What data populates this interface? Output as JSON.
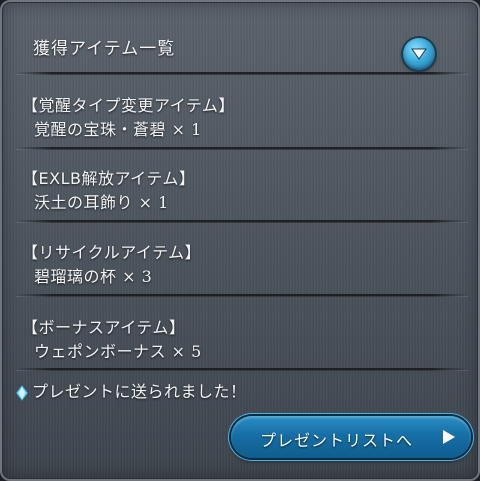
{
  "header": {
    "title": "獲得アイテム一覧"
  },
  "categories": [
    {
      "title": "【覚醒タイプ変更アイテム】",
      "item": "覚醒の宝珠・蒼碧",
      "qty": "× 1"
    },
    {
      "title": "【EXLB解放アイテム】",
      "item": "沃土の耳飾り",
      "qty": "× 1"
    },
    {
      "title": "【リサイクルアイテム】",
      "item": "碧瑠璃の杯",
      "qty": "× 3"
    },
    {
      "title": "【ボーナスアイテム】",
      "item": "ウェポンボーナス",
      "qty": "× 5"
    }
  ],
  "notice": "プレゼントに送られました！",
  "present_button": {
    "label": "プレゼントリストへ"
  },
  "colors": {
    "accent": "#2a8ec4",
    "panel": "#4c545d",
    "text": "#f2f4f6"
  },
  "icons": {
    "toggle": "chevron-down-icon",
    "notice": "diamond-gem-icon",
    "button": "play-arrow-icon"
  }
}
